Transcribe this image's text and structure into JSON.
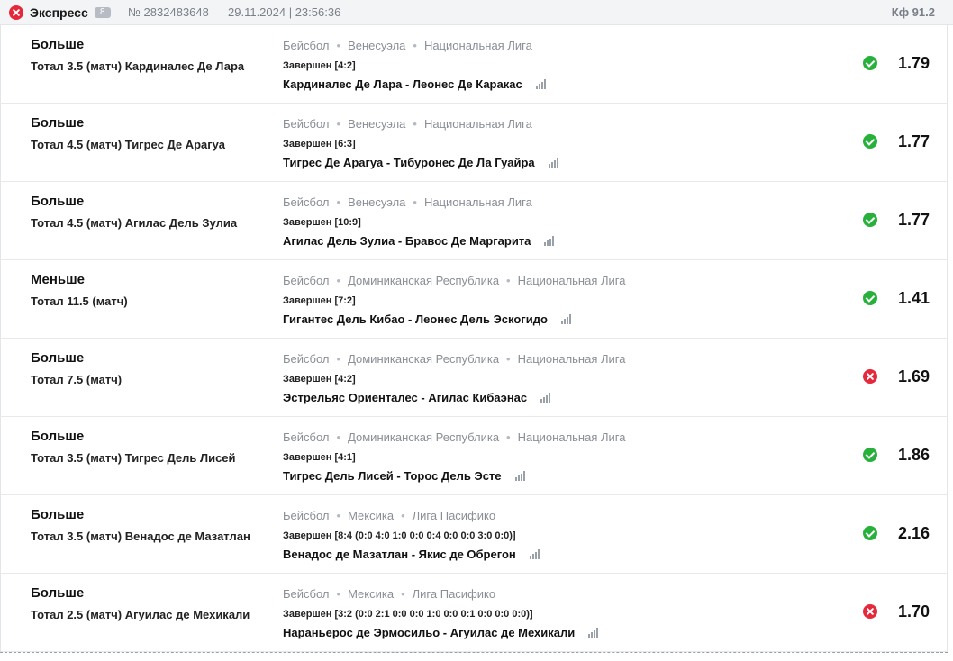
{
  "header": {
    "title": "Экспресс",
    "count": "8",
    "number": "№ 2832483648",
    "date": "29.11.2024 | 23:56:36",
    "coef": "Кф 91.2"
  },
  "bets": [
    {
      "type": "Больше",
      "desc": "Тотал 3.5 (матч) Кардиналес Де Лара",
      "sport": "Бейсбол",
      "country": "Венесуэла",
      "league": "Национальная Лига",
      "status": "Завершен [4:2]",
      "match": "Кардиналес Де Лара - Леонес Де Каракас",
      "result": "win",
      "odds": "1.79"
    },
    {
      "type": "Больше",
      "desc": "Тотал 4.5 (матч) Тигрес Де Арагуа",
      "sport": "Бейсбол",
      "country": "Венесуэла",
      "league": "Национальная Лига",
      "status": "Завершен [6:3]",
      "match": "Тигрес Де Арагуа - Тибуронес Де Ла Гуайра",
      "result": "win",
      "odds": "1.77"
    },
    {
      "type": "Больше",
      "desc": "Тотал 4.5 (матч) Агилас Дель Зулиа",
      "sport": "Бейсбол",
      "country": "Венесуэла",
      "league": "Национальная Лига",
      "status": "Завершен [10:9]",
      "match": "Агилас Дель Зулиа - Бравос Де Маргарита",
      "result": "win",
      "odds": "1.77"
    },
    {
      "type": "Меньше",
      "desc": "Тотал 11.5 (матч)",
      "sport": "Бейсбол",
      "country": "Доминиканская Республика",
      "league": "Национальная Лига",
      "status": "Завершен [7:2]",
      "match": "Гигантес Дель Кибао - Леонес Дель Эскогидо",
      "result": "win",
      "odds": "1.41"
    },
    {
      "type": "Больше",
      "desc": "Тотал 7.5 (матч)",
      "sport": "Бейсбол",
      "country": "Доминиканская Республика",
      "league": "Национальная Лига",
      "status": "Завершен [4:2]",
      "match": "Эстрельяс Ориенталес - Агилас Кибаэнас",
      "result": "lose",
      "odds": "1.69"
    },
    {
      "type": "Больше",
      "desc": "Тотал 3.5 (матч) Тигрес Дель Лисей",
      "sport": "Бейсбол",
      "country": "Доминиканская Республика",
      "league": "Национальная Лига",
      "status": "Завершен [4:1]",
      "match": "Тигрес Дель Лисей - Торос Дель Эсте",
      "result": "win",
      "odds": "1.86"
    },
    {
      "type": "Больше",
      "desc": "Тотал 3.5 (матч) Венадос де Мазатлан",
      "sport": "Бейсбол",
      "country": "Мексика",
      "league": "Лига Пасифико",
      "status": "Завершен [8:4 (0:0 4:0 1:0 0:0 0:4 0:0 0:0 3:0 0:0)]",
      "match": "Венадос де Мазатлан - Якис де Обрегон",
      "result": "win",
      "odds": "2.16"
    },
    {
      "type": "Больше",
      "desc": "Тотал 2.5 (матч) Агуилас де Мехикали",
      "sport": "Бейсбол",
      "country": "Мексика",
      "league": "Лига Пасифико",
      "status": "Завершен [3:2 (0:0 2:1 0:0 0:0 1:0 0:0 0:1 0:0 0:0 0:0)]",
      "match": "Нараньерос де Эрмосильо - Агуилас де Мехикали",
      "result": "lose",
      "odds": "1.70"
    }
  ]
}
